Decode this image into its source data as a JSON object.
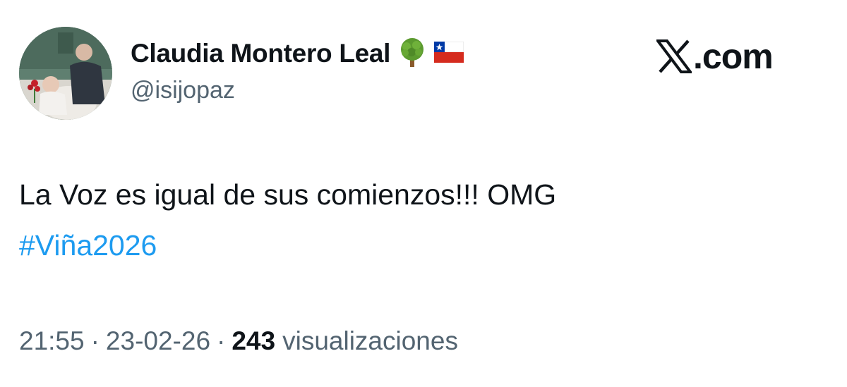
{
  "tweet": {
    "author": {
      "display_name": "Claudia Montero Leal",
      "handle": "@isijopaz",
      "avatar_icon": "profile-photo",
      "badge_icons": [
        "tree-emoji-icon",
        "chile-flag-emoji-icon"
      ]
    },
    "brand": {
      "logo_icon": "x-logo-icon",
      "text": ".com"
    },
    "text": "La Voz es igual de sus comienzos!!! OMG",
    "hashtag": "#Viña2026",
    "meta": {
      "time": "21:55",
      "separator": "·",
      "date": "23-02-26",
      "views_count": "243",
      "views_label": "visualizaciones"
    }
  },
  "colors": {
    "text": "#0f1419",
    "secondary": "#536471",
    "link": "#1d9bf0",
    "background": "#ffffff"
  }
}
